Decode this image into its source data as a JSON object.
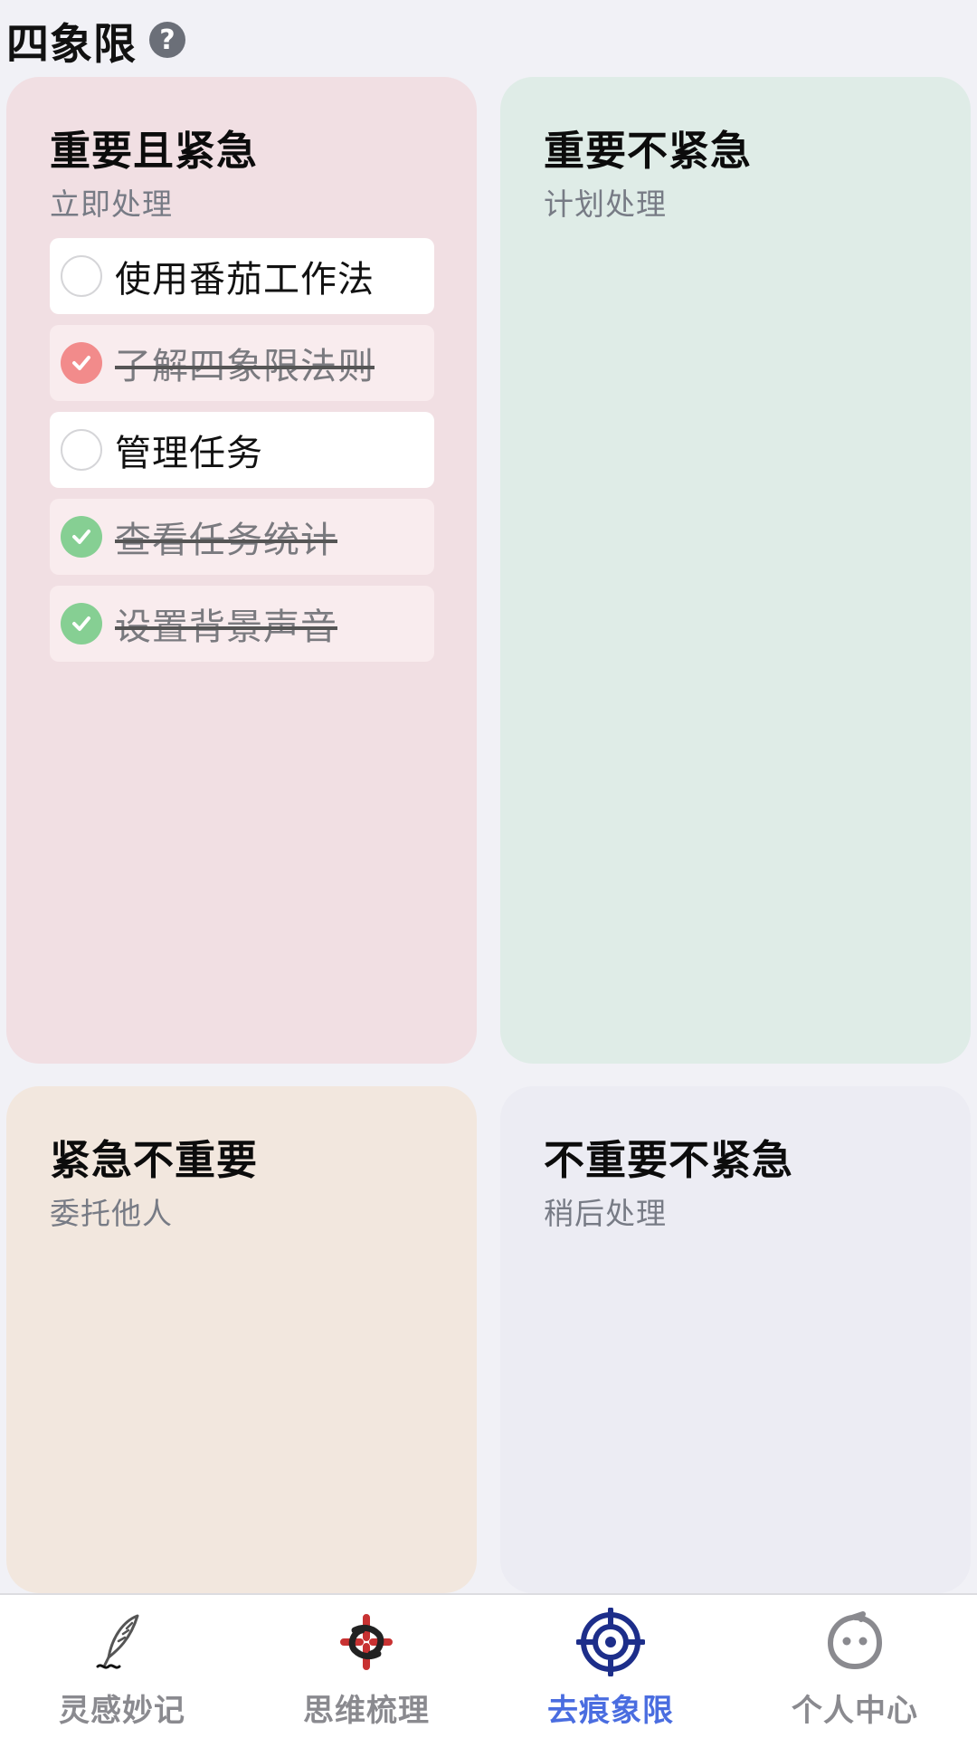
{
  "header": {
    "title": "四象限",
    "help_glyph": "?"
  },
  "quadrants": [
    {
      "title": "重要且紧急",
      "subtitle": "立即处理",
      "color": "#f1dfe3",
      "tasks": [
        {
          "label": "使用番茄工作法",
          "done": false
        },
        {
          "label": "了解四象限法则",
          "done": true,
          "check_color": "#f28b8b"
        },
        {
          "label": "管理任务",
          "done": false
        },
        {
          "label": "查看任务统计",
          "done": true,
          "check_color": "#86cf93"
        },
        {
          "label": "设置背景声音",
          "done": true,
          "check_color": "#86cf93"
        }
      ]
    },
    {
      "title": "重要不紧急",
      "subtitle": "计划处理",
      "color": "#dfece7",
      "tasks": []
    },
    {
      "title": "紧急不重要",
      "subtitle": "委托他人",
      "color": "#f2e7de",
      "tasks": []
    },
    {
      "title": "不重要不紧急",
      "subtitle": "稍后处理",
      "color": "#ececf3",
      "tasks": []
    }
  ],
  "tabbar": {
    "active_index": 2,
    "active_color": "#4a6de0",
    "items": [
      {
        "label": "灵感妙记",
        "icon": "quill-icon"
      },
      {
        "label": "思维梳理",
        "icon": "knot-icon"
      },
      {
        "label": "去痕象限",
        "icon": "target-icon"
      },
      {
        "label": "个人中心",
        "icon": "smiley-icon"
      }
    ]
  }
}
